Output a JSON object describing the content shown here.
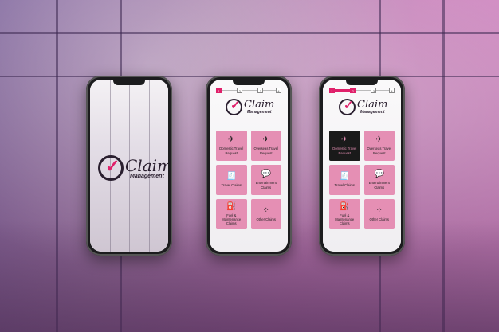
{
  "brand": {
    "name": "Claim",
    "tagline": "Management",
    "accent_color": "#e0206a",
    "tile_color": "#e58fb4"
  },
  "stepper": [
    "1",
    "2",
    "3",
    "4"
  ],
  "menu_items": [
    {
      "label": "Domestic Travel Request",
      "icon": "airplane-takeoff-icon",
      "glyph": "✈"
    },
    {
      "label": "Overseas Travel Request",
      "icon": "airplane-icon",
      "glyph": "✈"
    },
    {
      "label": "Travel Claims",
      "icon": "receipt-icon",
      "glyph": "🧾"
    },
    {
      "label": "Entertainment Claims",
      "icon": "chat-icon",
      "glyph": "💬"
    },
    {
      "label": "Fuel & Maintenance Claims",
      "icon": "fuel-pump-icon",
      "glyph": "⛽"
    },
    {
      "label": "Other Claims",
      "icon": "grid-icon",
      "glyph": "⁘"
    }
  ]
}
